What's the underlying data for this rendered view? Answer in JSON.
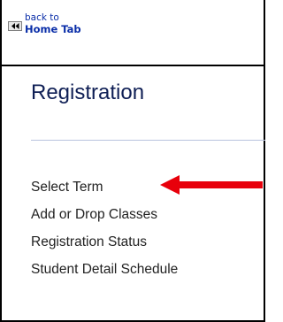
{
  "header": {
    "back_to": "back to",
    "home_tab": "Home Tab",
    "back_icon": "rewind-icon"
  },
  "page": {
    "title": "Registration"
  },
  "menu": {
    "items": [
      {
        "label": "Select Term"
      },
      {
        "label": "Add or Drop Classes"
      },
      {
        "label": "Registration Status"
      },
      {
        "label": "Student Detail Schedule"
      }
    ]
  },
  "annotation": {
    "arrow_color": "#e8000b",
    "points_to": "Select Term"
  },
  "colors": {
    "link": "#0a2ea8",
    "title": "#0f1f55",
    "menu_text": "#222222",
    "divider": "#b9c4de"
  }
}
